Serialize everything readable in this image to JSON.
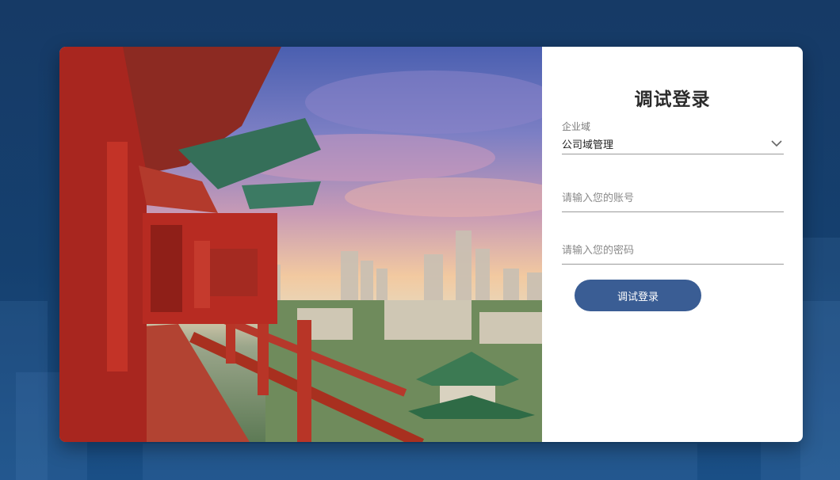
{
  "login": {
    "title": "调试登录",
    "domain_label": "企业域",
    "domain_value": "公司域管理",
    "account_placeholder": "请输入您的账号",
    "password_placeholder": "请输入您的密码",
    "submit_label": "调试登录"
  },
  "icons": {
    "select_arrow": "chevron-down-icon"
  },
  "colors": {
    "page_background": "#163a66",
    "button": "#3a5d94",
    "pavilion_red": "#b02a22"
  }
}
